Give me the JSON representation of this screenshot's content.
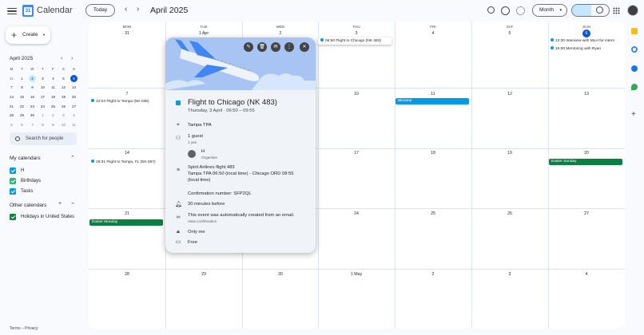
{
  "app": {
    "title": "Calendar",
    "logo_digit": "31"
  },
  "header": {
    "today_label": "Today",
    "prev": "‹",
    "next": "›",
    "month_label": "April 2025",
    "view_label": "Month",
    "view_caret": "▾"
  },
  "sidebar": {
    "create_label": "Create",
    "mini_cal": {
      "title": "April 2025",
      "weekdays": [
        "M",
        "T",
        "W",
        "T",
        "F",
        "S",
        "S"
      ],
      "weeks": [
        [
          "31",
          "1",
          "2",
          "3",
          "4",
          "5",
          "6"
        ],
        [
          "7",
          "8",
          "9",
          "10",
          "11",
          "12",
          "13"
        ],
        [
          "14",
          "15",
          "16",
          "17",
          "18",
          "19",
          "20"
        ],
        [
          "21",
          "22",
          "23",
          "24",
          "25",
          "26",
          "27"
        ],
        [
          "28",
          "29",
          "30",
          "1",
          "2",
          "3",
          "4"
        ],
        [
          "5",
          "6",
          "7",
          "8",
          "9",
          "10",
          "11"
        ]
      ]
    },
    "search_people": "Search for people",
    "my_calendars_title": "My calendars",
    "my_calendars": [
      {
        "label": "H",
        "color": "#039be5"
      },
      {
        "label": "Birthdays",
        "color": "#33b679"
      },
      {
        "label": "Tasks",
        "color": "#039be5"
      }
    ],
    "other_calendars_title": "Other calendars",
    "other_calendars": [
      {
        "label": "Holidays in United States",
        "color": "#0b8043"
      }
    ],
    "footer": "Terms – Privacy"
  },
  "grid": {
    "weekdays": [
      "MON",
      "TUE",
      "WED",
      "THU",
      "FRI",
      "SAT",
      "SUN"
    ],
    "weeks": [
      [
        "31",
        "1 Apr",
        "2",
        "3",
        "4",
        "5",
        "6"
      ],
      [
        "7",
        "8",
        "9",
        "10",
        "11",
        "12",
        "13"
      ],
      [
        "14",
        "15",
        "16",
        "17",
        "18",
        "19",
        "20"
      ],
      [
        "21",
        "22",
        "23",
        "24",
        "25",
        "26",
        "27"
      ],
      [
        "28",
        "29",
        "30",
        "1 May",
        "2",
        "3",
        "4"
      ]
    ],
    "events": {
      "thu3": "06:50 Flight to Chicago (NK 483)",
      "sun6_a": "12:30 Interview with MLH for intern",
      "sun6_b": "16:00 Mentoring with Ryan",
      "mon7": "12:04 Flight to Tampa (NK 538)",
      "fri11": "Bitcamp",
      "mon14": "18:31 Flight to Tampa, FL (NK 857)",
      "sun20": "Easter Sunday",
      "mon21": "Easter Monday"
    }
  },
  "popup": {
    "title": "Flight to Chicago (NK 483)",
    "time": "Thursday, 3 April  ·  06:50 – 09:55",
    "location": "Tampa TPA",
    "guests": "1 guest",
    "guests_sub": "1 yes",
    "organiser_name": "H",
    "organiser_role": "Organiser",
    "desc_line1": "Spirit Airlines flight 483",
    "desc_line2": "Tampa TPA 06:50 (local time) - Chicago ORD 08:55",
    "desc_line3": "(local time)",
    "confirmation": "Confirmation number: SFP2QL",
    "reminder": "30 minutes before",
    "auto_note": "This event was automatically created from an email.",
    "view_confirmation": "View confirmation",
    "visibility": "Only me",
    "availability": "Free"
  },
  "colors": {
    "accent": "#0b57d0",
    "event_blue": "#039be5",
    "holiday_green": "#0b8043",
    "popup_bg": "#f0f4f9",
    "hero_bg": "#a7c4f2"
  }
}
